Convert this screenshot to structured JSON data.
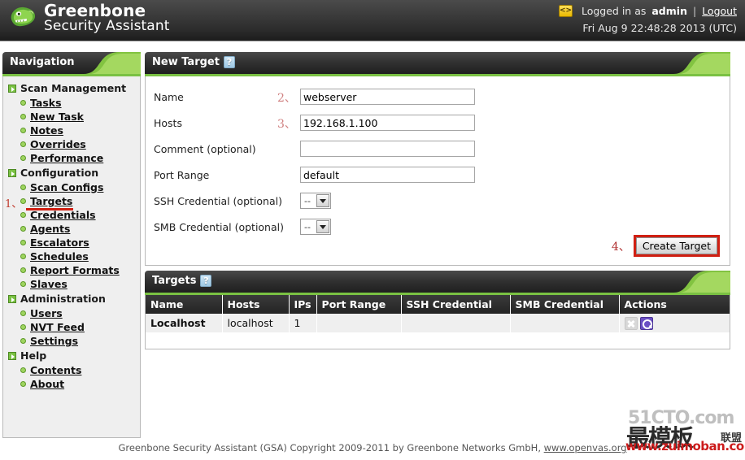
{
  "header": {
    "brand_line1": "Greenbone",
    "brand_line2": "Security Assistant",
    "logo_icon": "lizard-head-icon",
    "code_icon": "<>",
    "logged_in_prefix": "Logged in as ",
    "username": "admin",
    "separator": "|",
    "logout_label": "Logout",
    "datetime": "Fri Aug 9 22:48:28 2013 (UTC)"
  },
  "sidebar": {
    "title": "Navigation",
    "groups": [
      {
        "label": "Scan Management",
        "items": [
          {
            "label": "Tasks"
          },
          {
            "label": "New Task"
          },
          {
            "label": "Notes"
          },
          {
            "label": "Overrides"
          },
          {
            "label": "Performance"
          }
        ]
      },
      {
        "label": "Configuration",
        "items": [
          {
            "label": "Scan Configs"
          },
          {
            "label": "Targets",
            "annotation": "1、",
            "highlighted": true
          },
          {
            "label": "Credentials"
          },
          {
            "label": "Agents"
          },
          {
            "label": "Escalators"
          },
          {
            "label": "Schedules"
          },
          {
            "label": "Report Formats"
          },
          {
            "label": "Slaves"
          }
        ]
      },
      {
        "label": "Administration",
        "items": [
          {
            "label": "Users"
          },
          {
            "label": "NVT Feed"
          },
          {
            "label": "Settings"
          }
        ]
      },
      {
        "label": "Help",
        "items": [
          {
            "label": "Contents"
          },
          {
            "label": "About"
          }
        ]
      }
    ]
  },
  "new_target": {
    "title": "New Target",
    "help_icon": "?",
    "fields": [
      {
        "label": "Name",
        "value": "webserver",
        "annotation": "2、",
        "type": "text"
      },
      {
        "label": "Hosts",
        "value": "192.168.1.100",
        "annotation": "3、",
        "type": "text"
      },
      {
        "label": "Comment (optional)",
        "value": "",
        "annotation": "",
        "type": "text"
      },
      {
        "label": "Port Range",
        "value": "default",
        "annotation": "",
        "type": "text"
      },
      {
        "label": "SSH Credential (optional)",
        "value": "--",
        "annotation": "",
        "type": "select"
      },
      {
        "label": "SMB Credential (optional)",
        "value": "--",
        "annotation": "",
        "type": "select"
      }
    ],
    "create_annotation": "4、",
    "create_label": "Create Target"
  },
  "targets_panel": {
    "title": "Targets",
    "help_icon": "?",
    "columns": [
      "Name",
      "Hosts",
      "IPs",
      "Port Range",
      "SSH Credential",
      "SMB Credential",
      "Actions"
    ],
    "rows": [
      {
        "name": "Localhost",
        "hosts": "localhost",
        "ips": "1",
        "port_range": "",
        "ssh_credential": "",
        "smb_credential": "",
        "actions": [
          "delete-icon",
          "details-icon"
        ]
      }
    ]
  },
  "footer": {
    "text": "Greenbone Security Assistant (GSA) Copyright 2009-2011 by Greenbone Networks GmbH, ",
    "link": "www.openvas.org"
  },
  "watermark": {
    "line1": "51CTO.com",
    "line2": "最模板",
    "line3": "联盟",
    "line4": "www.zuimoban.com"
  },
  "colors": {
    "accent_green": "#7ac143",
    "annotation_red": "#d01f12",
    "panel_dark": "#2b2b2b"
  }
}
